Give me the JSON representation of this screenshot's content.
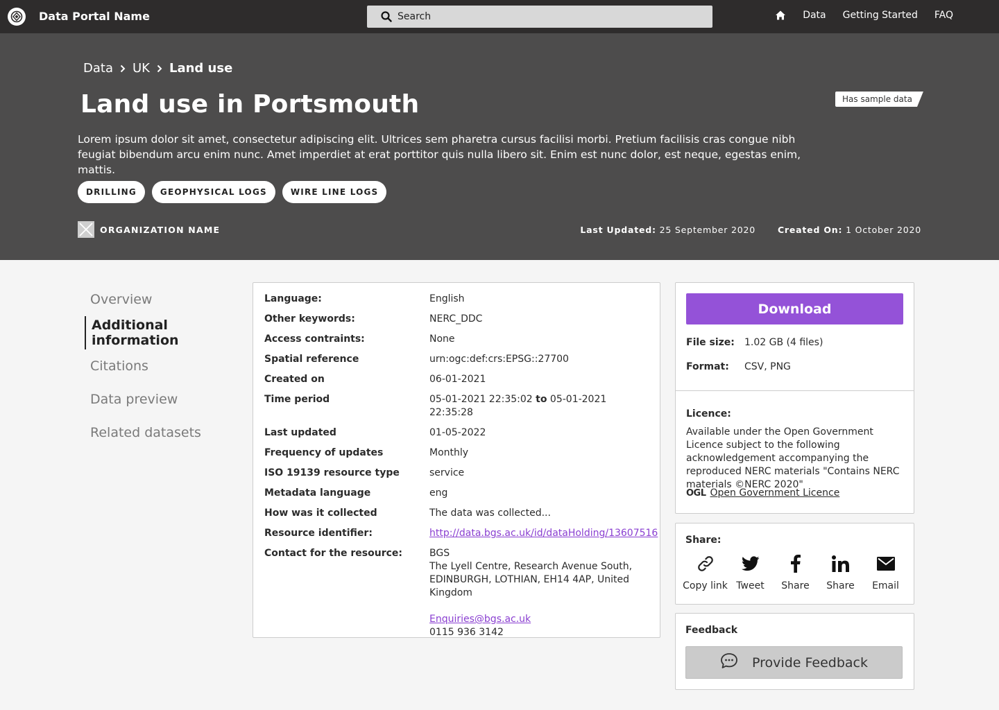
{
  "header": {
    "brand": "Data Portal Name",
    "search_placeholder": "Search",
    "nav": [
      "Data",
      "Getting Started",
      "FAQ"
    ]
  },
  "hero": {
    "breadcrumb": [
      "Data",
      "UK",
      "Land use"
    ],
    "title": "Land use in Portsmouth",
    "badge": "Has sample data",
    "description": "Lorem ipsum dolor sit amet, consectetur adipiscing elit. Ultrices sem pharetra cursus facilisi morbi. Pretium facilisis cras congue nibh feugiat bibendum arcu enim nunc. Amet imperdiet at erat porttitor quis nulla libero sit. Enim est nunc dolor, est neque, egestas enim, mattis.",
    "tags": [
      "DRILLING",
      "GEOPHYSICAL LOGS",
      "WIRE LINE LOGS"
    ],
    "organization": "ORGANIZATION NAME",
    "last_updated_label": "Last Updated:",
    "last_updated": "25 September 2020",
    "created_on_label": "Created On:",
    "created_on": "1 October 2020"
  },
  "sidenav": {
    "items": [
      "Overview",
      "Additional information",
      "Citations",
      "Data preview",
      "Related datasets"
    ],
    "active": "Additional information"
  },
  "info": {
    "rows": [
      {
        "k": "Language:",
        "v": "English"
      },
      {
        "k": "Other keywords:",
        "v": "NERC_DDC"
      },
      {
        "k": "Access contraints:",
        "v": "None"
      },
      {
        "k": "Spatial reference",
        "v": "urn:ogc:def:crs:EPSG::27700"
      },
      {
        "k": "Created on",
        "v": "06-01-2021"
      },
      {
        "k": "Time period",
        "v_start": "05-01-2021 22:35:02",
        "v_to": "to",
        "v_end": "05-01-2021 22:35:28"
      },
      {
        "k": "Last updated",
        "v": "01-05-2022"
      },
      {
        "k": "Frequency of updates",
        "v": "Monthly"
      },
      {
        "k": "ISO 19139 resource type",
        "v": "service"
      },
      {
        "k": "Metadata language",
        "v": "eng"
      },
      {
        "k": "How was it collected",
        "v": "The data was collected..."
      },
      {
        "k": "Resource identifier:",
        "link": "http://data.bgs.ac.uk/id/dataHolding/13607516"
      }
    ],
    "contact": {
      "k": "Contact for the resource:",
      "name": "BGS",
      "address": "The Lyell Centre, Research Avenue South, EDINBURGH, LOTHIAN, EH14 4AP, United Kingdom",
      "email": "Enquiries@bgs.ac.uk",
      "phone": "0115 936 3142"
    }
  },
  "download": {
    "button": "Download",
    "file_size_label": "File size:",
    "file_size": "1.02 GB (4 files)",
    "format_label": "Format:",
    "format": "CSV, PNG",
    "licence_label": "Licence:",
    "licence_text": "Available under the Open Government Licence subject to the following acknowledgement accompanying the reproduced NERC materials \"Contains NERC materials ©NERC 2020\"",
    "ogl_mark": "OGL",
    "ogl_link": "Open Government Licence"
  },
  "share": {
    "title": "Share:",
    "items": [
      "Copy link",
      "Tweet",
      "Share",
      "Share",
      "Email"
    ]
  },
  "feedback": {
    "title": "Feedback",
    "button": "Provide Feedback"
  },
  "colors": {
    "accent": "#9452d8",
    "topbar": "#2e2c2c",
    "hero": "#4d4c4c",
    "link": "#8a3fd1"
  }
}
